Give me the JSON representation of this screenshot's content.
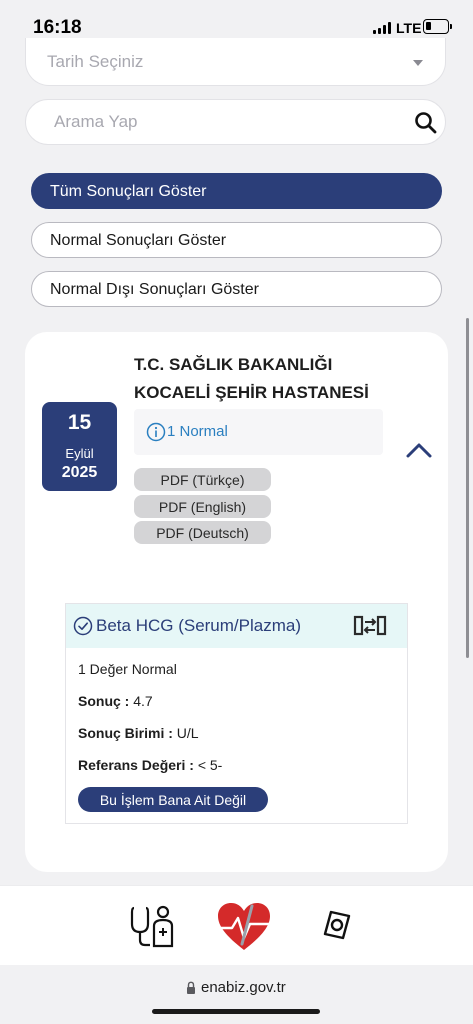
{
  "status_bar": {
    "time": "16:18",
    "network": "LTE",
    "battery_level": 0.25
  },
  "filters": {
    "date_placeholder": "Tarih Seçiniz",
    "search_placeholder": "Arama Yap",
    "buttons": [
      {
        "label": "Tüm Sonuçları Göster",
        "active": true
      },
      {
        "label": "Normal Sonuçları Göster",
        "active": false
      },
      {
        "label": "Normal Dışı Sonuçları Göster",
        "active": false
      }
    ]
  },
  "result_card": {
    "hospital_line1": "T.C. SAĞLIK BAKANLIĞI",
    "hospital_line2": "KOCAELİ ŞEHİR HASTANESİ",
    "date": {
      "day": "15",
      "month": "Eylül",
      "year": "2025"
    },
    "status_text": "1 Normal",
    "pdf_buttons": [
      "PDF (Türkçe)",
      "PDF (English)",
      "PDF (Deutsch)"
    ],
    "test": {
      "name": "Beta HCG (Serum/Plazma)",
      "summary": "1 Değer Normal",
      "result_label": "Sonuç :",
      "result_value": "4.7",
      "unit_label": "Sonuç Birimi :",
      "unit_value": "U/L",
      "reference_label": "Referans Değeri :",
      "reference_value": "< 5-",
      "not_mine_button": "Bu İşlem Bana Ait Değil"
    }
  },
  "bottom_nav": {
    "items": [
      "doctor-patient-icon",
      "heart-logo-icon",
      "capsule-icon"
    ]
  },
  "browser": {
    "url": "enabiz.gov.tr"
  },
  "colors": {
    "primary": "#2b3e79",
    "info": "#2a7fc0",
    "test_header_bg": "#e6f7f7",
    "logo_red": "#d42a2a"
  }
}
